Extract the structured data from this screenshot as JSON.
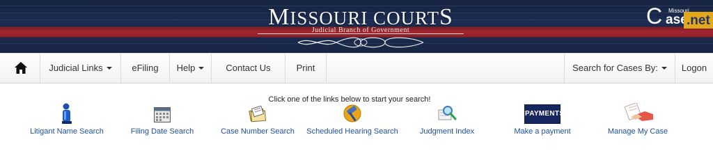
{
  "banner": {
    "title_big_m": "M",
    "title_rest": "ISSOURI COURT",
    "title_big_s": "S",
    "subtitle": "Judicial Branch of Government",
    "casenet_c": "C",
    "casenet_missouri": "Missouri",
    "casenet_ase": "ase",
    "casenet_net": ".net"
  },
  "nav": {
    "home": "home",
    "judicial_links": "Judicial Links",
    "efiling": "eFiling",
    "help": "Help",
    "contact_us": "Contact Us",
    "print": "Print",
    "search_cases_by": "Search for Cases By:",
    "logon": "Logon"
  },
  "search": {
    "instructions": "Click one of the links below to start your search!",
    "links": [
      {
        "label": "Litigant Name Search",
        "icon": "person-icon"
      },
      {
        "label": "Filing Date Search",
        "icon": "calendar-icon"
      },
      {
        "label": "Case Number Search",
        "icon": "file-cards-icon"
      },
      {
        "label": "Scheduled Hearing Search",
        "icon": "gavel-icon"
      },
      {
        "label": "Judgment Index",
        "icon": "magnifier-icon"
      },
      {
        "label": "Make a payment",
        "icon": "payments-icon",
        "icon_text": "PAYMENTS"
      },
      {
        "label": "Manage My Case",
        "icon": "hand-document-icon"
      }
    ]
  },
  "colors": {
    "banner_navy": "#1c2d52",
    "banner_red": "#a3252e",
    "link_blue": "#1e4f9e",
    "casenet_gold": "#e2a81c"
  }
}
